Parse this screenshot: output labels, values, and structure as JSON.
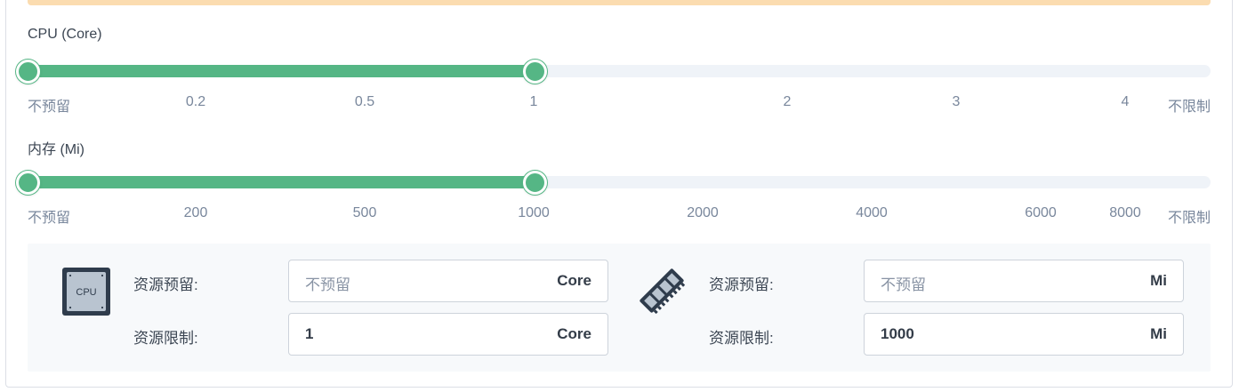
{
  "cpu": {
    "title": "CPU (Core)",
    "ticks": [
      "不预留",
      "0.2",
      "0.5",
      "1",
      "2",
      "3",
      "4",
      "不限制"
    ],
    "range": {
      "reserve": "不预留",
      "limit": "1"
    },
    "fill_fraction": 0.4286,
    "accent": "#55b685"
  },
  "memory": {
    "title": "内存 (Mi)",
    "ticks": [
      "不预留",
      "200",
      "500",
      "1000",
      "2000",
      "4000",
      "6000",
      "8000",
      "不限制"
    ],
    "range": {
      "reserve": "不预留",
      "limit": "1000"
    },
    "fill_fraction": 0.4286,
    "accent": "#55b685"
  },
  "resources": {
    "cpu_icon_text": "CPU",
    "cpu": {
      "reserve_label": "资源预留:",
      "reserve_placeholder": "不预留",
      "reserve_unit": "Core",
      "limit_label": "资源限制:",
      "limit_value": "1",
      "limit_unit": "Core"
    },
    "memory": {
      "reserve_label": "资源预留:",
      "reserve_placeholder": "不预留",
      "reserve_unit": "Mi",
      "limit_label": "资源限制:",
      "limit_value": "1000",
      "limit_unit": "Mi"
    }
  }
}
